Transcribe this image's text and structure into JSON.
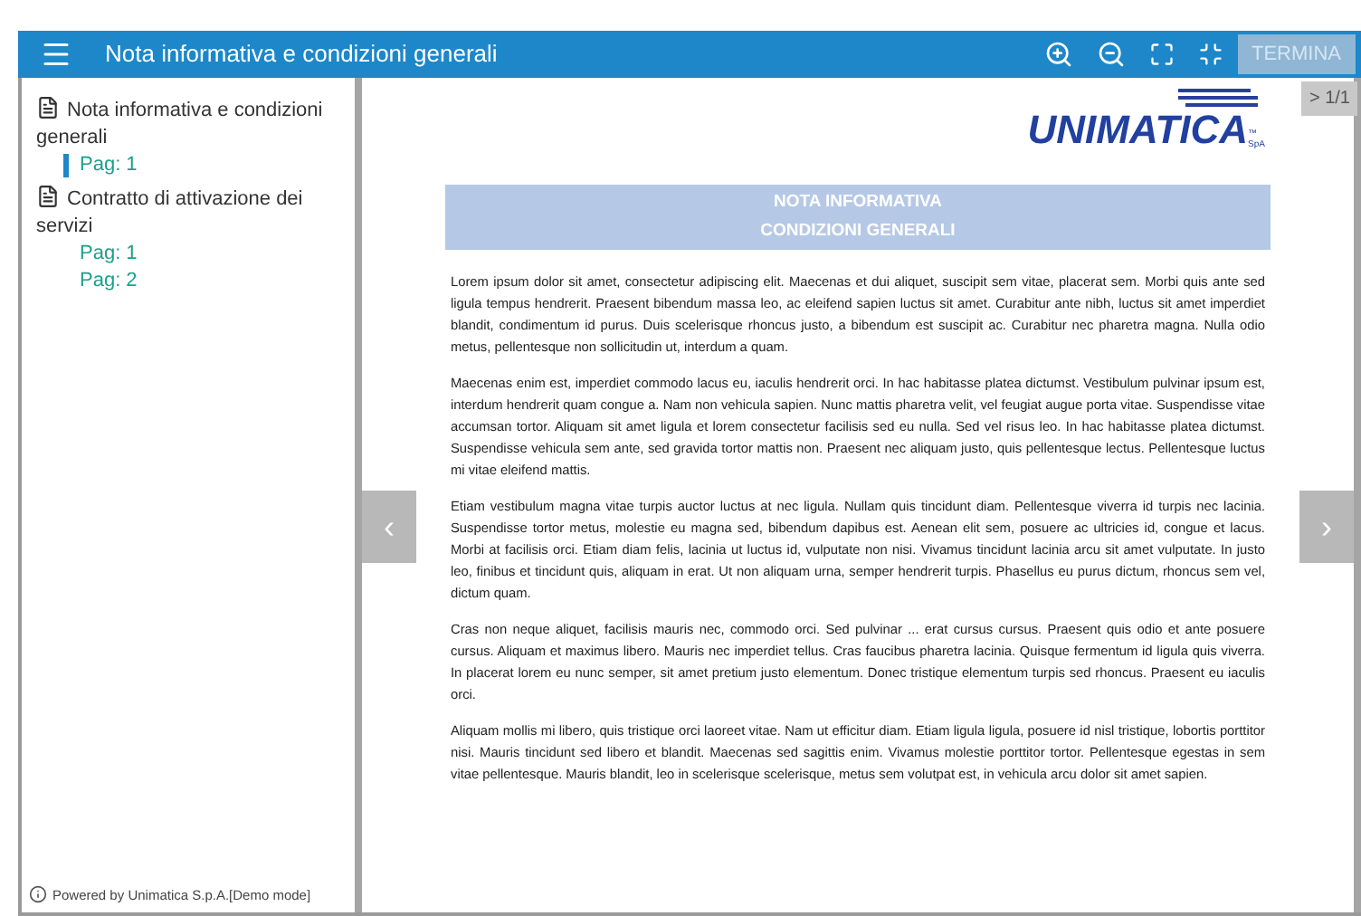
{
  "toolbar": {
    "title": "Nota informativa e condizioni generali",
    "finish_button": {
      "label": "TERMINA",
      "disabled": true
    }
  },
  "sidebar": {
    "documents": [
      {
        "title": "Nota informativa e condizioni generali",
        "pages": [
          {
            "label": "Pag: 1",
            "selected": true
          }
        ]
      },
      {
        "title": "Contratto di attivazione dei servizi",
        "pages": [
          {
            "label": "Pag: 1",
            "selected": false
          },
          {
            "label": "Pag: 2",
            "selected": false
          }
        ]
      }
    ],
    "footer": "Powered by Unimatica S.p.A.[Demo mode]"
  },
  "viewer": {
    "page_indicator": "> 1/1",
    "logo": {
      "text": "UNIMATICA",
      "tm": "™",
      "suffix": "SpA"
    },
    "heading": [
      "NOTA INFORMATIVA",
      "CONDIZIONI GENERALI"
    ],
    "paragraphs": [
      "Lorem ipsum dolor sit amet, consectetur adipiscing elit. Maecenas et dui aliquet, suscipit sem vitae, placerat sem. Morbi quis ante sed ligula tempus hendrerit. Praesent bibendum massa leo, ac eleifend sapien luctus sit amet. Curabitur ante nibh, luctus sit amet imperdiet blandit, condimentum id purus. Duis scelerisque rhoncus justo, a bibendum est suscipit ac. Curabitur nec pharetra magna. Nulla odio metus, pellentesque non sollicitudin ut, interdum a quam.",
      "Maecenas enim est, imperdiet commodo lacus eu, iaculis hendrerit orci. In hac habitasse platea dictumst. Vestibulum pulvinar ipsum est, interdum hendrerit quam congue a. Nam non vehicula sapien. Nunc mattis pharetra velit, vel feugiat augue porta vitae. Suspendisse vitae accumsan tortor. Aliquam sit amet ligula et lorem consectetur facilisis sed eu nulla. Sed vel risus leo. In hac habitasse platea dictumst. Suspendisse vehicula sem ante, sed gravida tortor mattis non. Praesent nec aliquam justo, quis pellentesque lectus. Pellentesque luctus mi vitae eleifend mattis.",
      "Etiam vestibulum magna vitae turpis auctor luctus at nec ligula. Nullam quis tincidunt diam. Pellentesque viverra id turpis nec lacinia. Suspendisse tortor metus, molestie eu magna sed, bibendum dapibus est. Aenean elit sem, posuere ac ultricies id, congue et lacus. Morbi at facilisis orci. Etiam diam felis, lacinia ut luctus id, vulputate non nisi. Vivamus tincidunt lacinia arcu sit amet vulputate. In justo leo, finibus et tincidunt quis, aliquam in erat. Ut non aliquam urna, semper hendrerit turpis. Phasellus eu purus dictum, rhoncus sem vel, dictum quam.",
      "Cras non neque aliquet, facilisis mauris nec, commodo orci. Sed pulvinar ... erat cursus cursus. Praesent quis odio et ante posuere cursus. Aliquam et maximus libero. Mauris nec imperdiet tellus. Cras faucibus pharetra lacinia. Quisque fermentum id ligula quis viverra. In placerat lorem eu nunc semper, sit amet pretium justo elementum. Donec tristique elementum turpis sed rhoncus. Praesent eu iaculis orci.",
      "Aliquam mollis mi libero, quis tristique orci laoreet vitae. Nam ut efficitur diam. Etiam ligula ligula, posuere id nisl tristique, lobortis porttitor nisi. Mauris tincidunt sed libero et blandit. Maecenas sed sagittis enim. Vivamus molestie porttitor tortor. Pellentesque egestas in sem vitae pellentesque. Mauris blandit, leo in scelerisque scelerisque, metus sem volutpat est, in vehicula arcu dolor sit amet sapien."
    ],
    "prev_arrow": "‹",
    "next_arrow": "›"
  }
}
